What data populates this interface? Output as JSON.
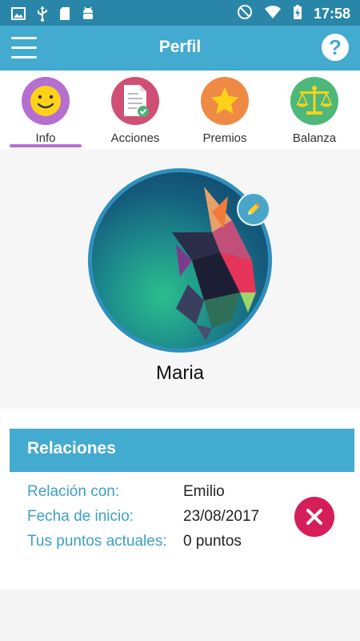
{
  "status_bar": {
    "time": "17:58",
    "left_icons": [
      "image-icon",
      "usb-icon",
      "sd-card-icon",
      "android-icon"
    ],
    "right_icons": [
      "do-not-disturb-icon",
      "wifi-icon",
      "battery-charging-icon"
    ]
  },
  "app_bar": {
    "title": "Perfil",
    "help_label": "?"
  },
  "tabs": [
    {
      "label": "Info",
      "icon": "smiley-icon",
      "color": "#b46fd0",
      "selected": true
    },
    {
      "label": "Acciones",
      "icon": "document-check-icon",
      "color": "#d04f74",
      "selected": false
    },
    {
      "label": "Premios",
      "icon": "star-icon",
      "color": "#ef8a45",
      "selected": false
    },
    {
      "label": "Balanza",
      "icon": "scales-icon",
      "color": "#4db87a",
      "selected": false
    }
  ],
  "profile": {
    "name": "Maria"
  },
  "relations": {
    "header": "Relaciones",
    "rows": [
      {
        "key": "Relación con:",
        "value": "Emilio"
      },
      {
        "key": "Fecha de inicio:",
        "value": "23/08/2017"
      },
      {
        "key": "Tus puntos actuales:",
        "value": "0 puntos"
      }
    ]
  },
  "colors": {
    "status_bar": "#2a86a8",
    "app_bar": "#43aad0",
    "accent_text": "#3da0c6",
    "remove_button": "#d61f5a"
  }
}
